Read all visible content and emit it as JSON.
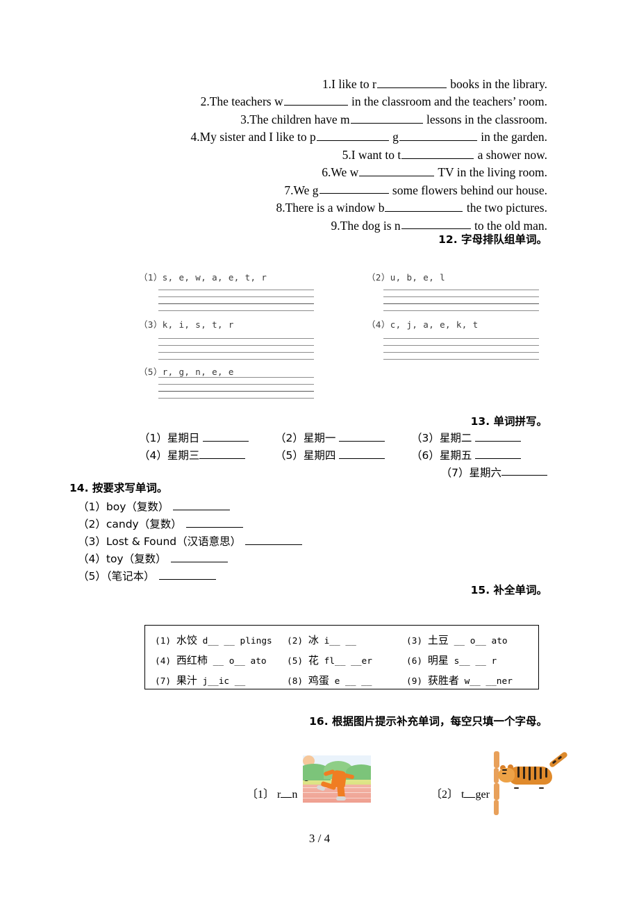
{
  "page": {
    "footer": "3 / 4"
  },
  "sentences": {
    "items": [
      {
        "num": "1.",
        "pre": "I like to r",
        "post": " books in the library.",
        "blank": "b100"
      },
      {
        "num": "2.",
        "pre": "The teachers w",
        "post": " in the classroom and the teachers’ room.",
        "blank": "b92"
      },
      {
        "num": "3.",
        "pre": "The children have m",
        "post": " lessons in the classroom.",
        "blank": "b104"
      },
      {
        "num": "4.",
        "pre": "My sister and I like to p",
        "mid": " g",
        "post": " in the garden.",
        "blank": "b104",
        "blank2": "b112"
      },
      {
        "num": "5.",
        "pre": "I want to t",
        "post": " a shower now.",
        "blank": "b104"
      },
      {
        "num": "6.",
        "pre": "We w",
        "post": " TV in the living room.",
        "blank": "b108"
      },
      {
        "num": "7.",
        "pre": "We g",
        "post": " some flowers behind our house.",
        "blank": "b100"
      },
      {
        "num": "8.",
        "pre": "There is a window b",
        "post": " the two pictures.",
        "blank": "b112"
      },
      {
        "num": "9.",
        "pre": "The dog is n",
        "post": " to the old man.",
        "blank": "b100"
      }
    ]
  },
  "section12": {
    "heading": "12. 字母排队组单词。",
    "items": [
      {
        "label": "（1）",
        "letters": "s, e, w, a, e, t, r"
      },
      {
        "label": "（2）",
        "letters": "u, b, e, l"
      },
      {
        "label": "（3）",
        "letters": "k, i, s, t, r"
      },
      {
        "label": "（4）",
        "letters": "c, j, a, e, k, t"
      },
      {
        "label": "（5）",
        "letters": "r, g, n, e, e"
      }
    ]
  },
  "section13": {
    "heading": "13. 单词拼写。",
    "items": [
      {
        "label": "（1）",
        "text": "星期日"
      },
      {
        "label": "（2）",
        "text": "星期一"
      },
      {
        "label": "（3）",
        "text": "星期二"
      },
      {
        "label": "（4）",
        "text": "星期三"
      },
      {
        "label": "（5）",
        "text": "星期四"
      },
      {
        "label": "（6）",
        "text": "星期五"
      },
      {
        "label": "（7）",
        "text": "星期六"
      }
    ]
  },
  "section14": {
    "heading": "14. 按要求写单词。",
    "items": [
      {
        "label": "（1）",
        "text": "boy（复数）"
      },
      {
        "label": "（2）",
        "text": "candy（复数）"
      },
      {
        "label": "（3）",
        "text": "Lost & Found（汉语意思）"
      },
      {
        "label": "（4）",
        "text": "toy（复数）"
      },
      {
        "label": "（5）",
        "text": "（笔记本）"
      }
    ]
  },
  "section15": {
    "heading": "15. 补全单词。",
    "items": [
      {
        "label": "(1)",
        "han": "水饺",
        "word": "d__ __ plings"
      },
      {
        "label": "(2)",
        "han": "冰",
        "word": "i__ __"
      },
      {
        "label": "(3)",
        "han": "土豆",
        "word": "__ o__ ato"
      },
      {
        "label": "(4)",
        "han": "西红柿",
        "word": "__ o__ ato"
      },
      {
        "label": "(5)",
        "han": "花",
        "word": "fl__ __er"
      },
      {
        "label": "(6)",
        "han": "明星",
        "word": "s__ __ r"
      },
      {
        "label": "(7)",
        "han": "果汁",
        "word": "j__ic __"
      },
      {
        "label": "(8)",
        "han": "鸡蛋",
        "word": "e __ __"
      },
      {
        "label": "(9)",
        "han": "获胜者",
        "word": "w__ __ner"
      }
    ]
  },
  "section16": {
    "heading": "16. 根据图片提示补充单词，每空只填一个字母。",
    "items": [
      {
        "label": "〔1〕",
        "prefix": "r",
        "suffix": "n",
        "picture": "runner-image"
      },
      {
        "label": "〔2〕",
        "prefix": "t",
        "suffix": "ger",
        "picture": "tiger-image"
      }
    ]
  }
}
